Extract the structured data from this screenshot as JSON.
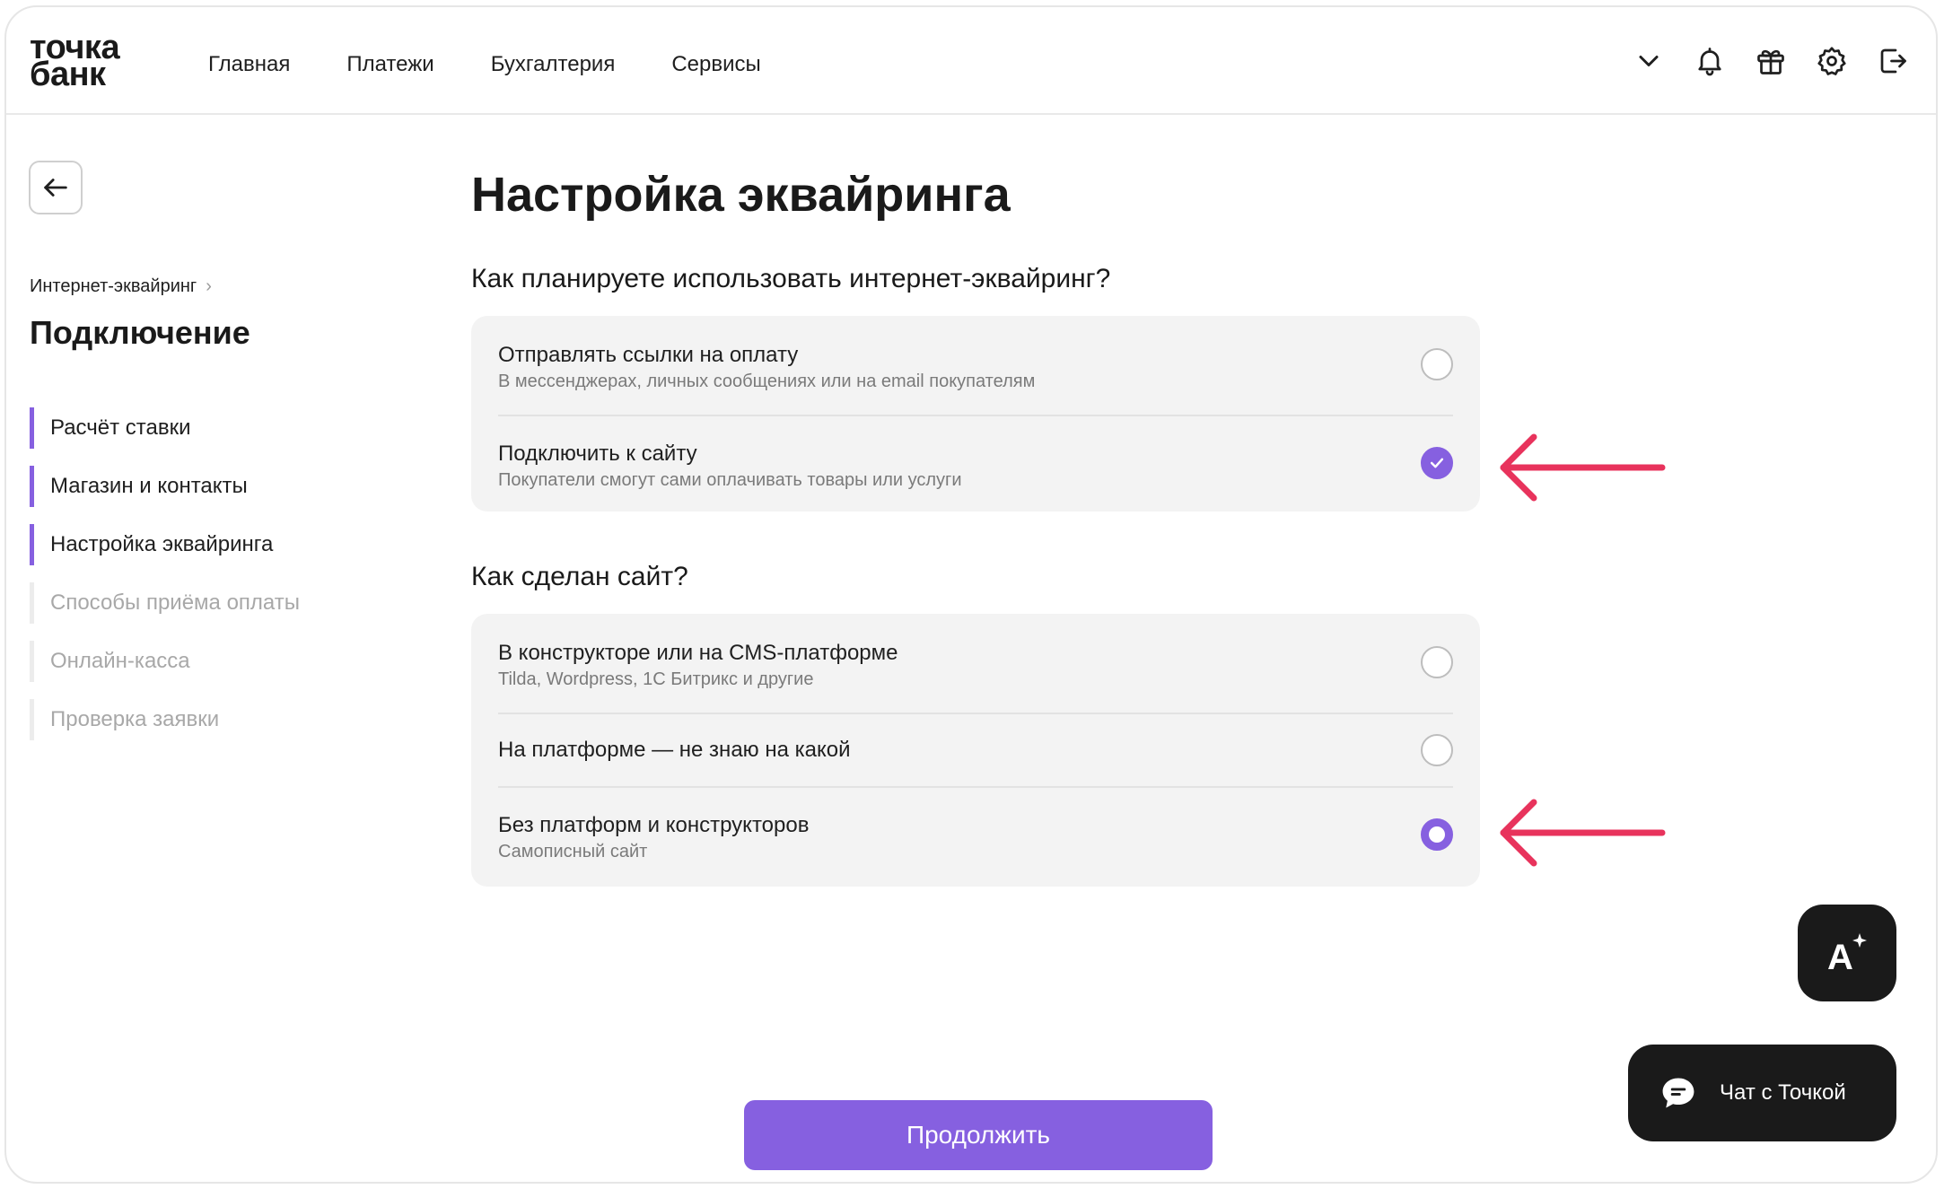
{
  "header": {
    "logo_line1": "точка",
    "logo_line2": "банк",
    "nav": [
      "Главная",
      "Платежи",
      "Бухгалтерия",
      "Сервисы"
    ],
    "icons": [
      "chevron-down-icon",
      "bell-icon",
      "gift-icon",
      "gear-icon",
      "logout-icon"
    ]
  },
  "sidebar": {
    "breadcrumb": "Интернет-эквайринг",
    "breadcrumb_separator": "›",
    "title": "Подключение",
    "steps": [
      {
        "label": "Расчёт ставки",
        "state": "done"
      },
      {
        "label": "Магазин и контакты",
        "state": "done"
      },
      {
        "label": "Настройка эквайринга",
        "state": "current"
      },
      {
        "label": "Способы приёма оплаты",
        "state": "pending"
      },
      {
        "label": "Онлайн-касса",
        "state": "pending"
      },
      {
        "label": "Проверка заявки",
        "state": "pending"
      }
    ]
  },
  "main": {
    "title": "Настройка эквайринга",
    "q1": {
      "title": "Как планируете использовать интернет-эквайринг?",
      "options": [
        {
          "title": "Отправлять ссылки на оплату",
          "subtitle": "В мессенджерах, личных сообщениях или на email покупателям",
          "state": "unchecked"
        },
        {
          "title": "Подключить к сайту",
          "subtitle": "Покупатели смогут сами оплачивать товары или услуги",
          "state": "checked"
        }
      ]
    },
    "q2": {
      "title": "Как сделан сайт?",
      "options": [
        {
          "title": "В конструкторе или на CMS-платформе",
          "subtitle": "Tilda, Wordpress, 1C Битрикс и другие",
          "state": "unchecked"
        },
        {
          "title": "На платформе — не знаю на какой",
          "subtitle": "",
          "state": "unchecked"
        },
        {
          "title": "Без платформ и конструкторов",
          "subtitle": "Самописный сайт",
          "state": "selected"
        }
      ]
    },
    "continue_label": "Продолжить"
  },
  "widgets": {
    "chat_label": "Чат с Точкой",
    "ai_label": "A"
  },
  "colors": {
    "accent": "#8660e0",
    "annotation_arrow": "#e8335c",
    "dark": "#1a1a1a"
  }
}
